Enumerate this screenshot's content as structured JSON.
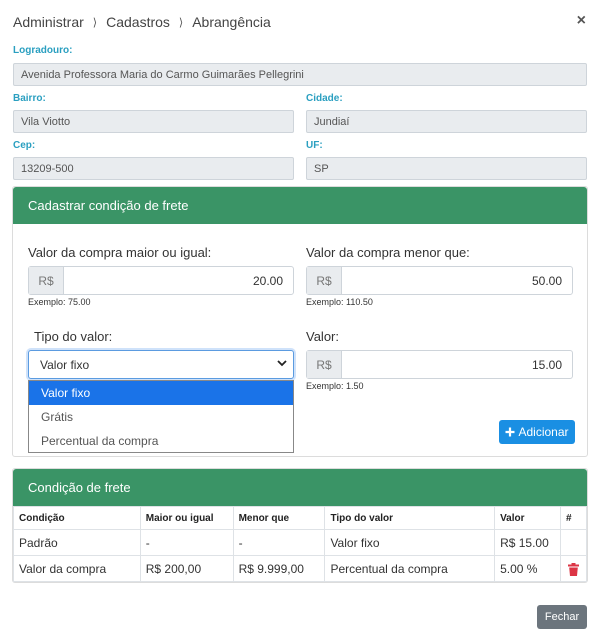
{
  "breadcrumb": [
    "Administrar",
    "Cadastros",
    "Abrangência"
  ],
  "close_symbol": "×",
  "address": {
    "logradouro_label": "Logradouro:",
    "logradouro": "Avenida Professora Maria do Carmo Guimarães Pellegrini",
    "bairro_label": "Bairro:",
    "bairro": "Vila Viotto",
    "cidade_label": "Cidade:",
    "cidade": "Jundiaí",
    "cep_label": "Cep:",
    "cep": "13209-500",
    "uf_label": "UF:",
    "uf": "SP"
  },
  "form": {
    "title": "Cadastrar condição de frete",
    "min_label": "Valor da compra maior ou igual:",
    "min_prefix": "R$",
    "min_value": "20.00",
    "min_hint": "Exemplo: 75.00",
    "max_label": "Valor da compra menor que:",
    "max_prefix": "R$",
    "max_value": "50.00",
    "max_hint": "Exemplo: 110.50",
    "type_label": "Tipo do valor:",
    "type_selected": "Valor fixo",
    "type_options": [
      "Valor fixo",
      "Grátis",
      "Percentual da compra"
    ],
    "value_label": "Valor:",
    "value_prefix": "R$",
    "value_value": "15.00",
    "value_hint": "Exemplo: 1.50",
    "add_button": "Adicionar"
  },
  "table": {
    "title": "Condição de frete",
    "columns": [
      "Condição",
      "Maior ou igual",
      "Menor que",
      "Tipo do valor",
      "Valor",
      "#"
    ],
    "rows": [
      [
        "Padrão",
        "-",
        "-",
        "Valor fixo",
        "R$ 15.00"
      ],
      [
        "Valor da compra",
        "R$ 200,00",
        "R$ 9.999,00",
        "Percentual da compra",
        "5.00 %"
      ]
    ]
  },
  "footer": {
    "close_button": "Fechar"
  },
  "colors": {
    "card_header": "#3a9466",
    "label_accent": "#2a9fc0",
    "primary": "#1a8fe3",
    "danger": "#dc3545"
  }
}
